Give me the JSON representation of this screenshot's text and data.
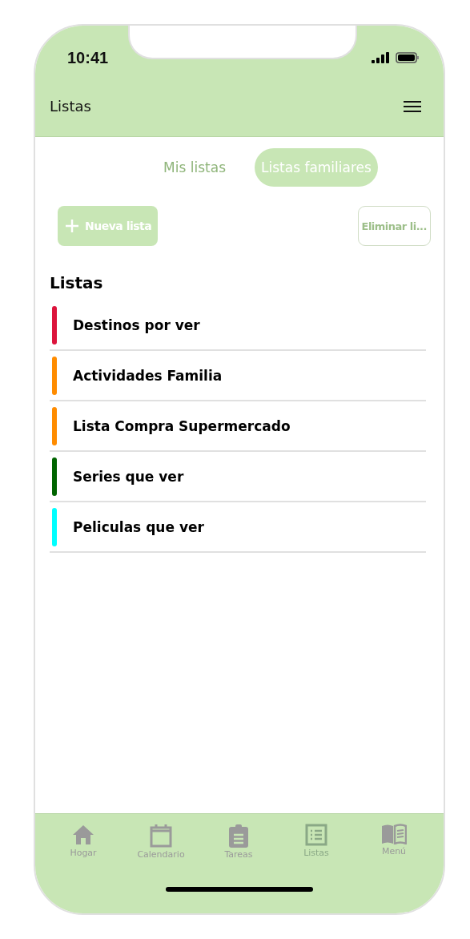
{
  "status_bar": {
    "time": "10:41"
  },
  "header": {
    "title": "Listas"
  },
  "tabs": [
    {
      "label": "Mis listas",
      "selected": false
    },
    {
      "label": "Listas familiares",
      "selected": true
    }
  ],
  "actions": {
    "new_button": "Nueva lista",
    "delete_button": "Eliminar li..."
  },
  "section_title": "Listas",
  "lists": [
    {
      "name": "Destinos por ver",
      "color": "#dc143c"
    },
    {
      "name": "Actividades Familia",
      "color": "#ff8c00"
    },
    {
      "name": "Lista Compra Supermercado",
      "color": "#ff8c00"
    },
    {
      "name": "Series que ver",
      "color": "#006400"
    },
    {
      "name": "Peliculas que ver",
      "color": "#00ffff"
    }
  ],
  "nav": [
    {
      "kind": "home",
      "label": "Hogar",
      "selected": false
    },
    {
      "kind": "calendar",
      "label": "Calendario",
      "selected": false
    },
    {
      "kind": "tasks",
      "label": "Tareas",
      "selected": false
    },
    {
      "kind": "lists",
      "label": "Listas",
      "selected": true
    },
    {
      "kind": "menu",
      "label": "Menú",
      "selected": false
    }
  ]
}
